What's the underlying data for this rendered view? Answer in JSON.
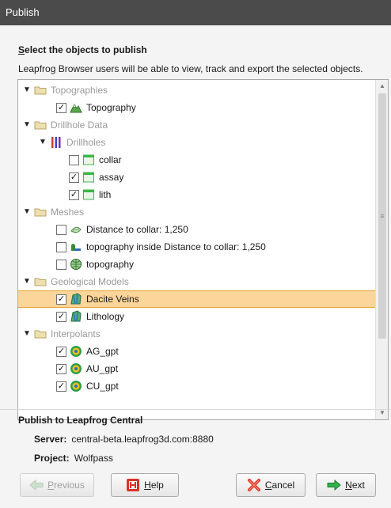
{
  "window": {
    "title": "Publish"
  },
  "section": {
    "title_mnemonic": "S",
    "title_rest": "elect the objects to publish",
    "description": "Leapfrog Browser users will be able to view, track and export the selected objects."
  },
  "tree": [
    {
      "label": "Topographies",
      "grey": true
    },
    {
      "label": "Topography",
      "checked": "✓"
    },
    {
      "label": "Drillhole Data",
      "grey": true
    },
    {
      "label": "Drillholes",
      "grey": true
    },
    {
      "label": "collar",
      "checked": ""
    },
    {
      "label": "assay",
      "checked": "✓"
    },
    {
      "label": "lith",
      "checked": "✓"
    },
    {
      "label": "Meshes",
      "grey": true
    },
    {
      "label": "Distance to collar: 1,250",
      "checked": ""
    },
    {
      "label": "topography inside Distance to collar: 1,250",
      "checked": ""
    },
    {
      "label": "topography",
      "checked": ""
    },
    {
      "label": "Geological Models",
      "grey": true
    },
    {
      "label": "Dacite Veins",
      "checked": "✓",
      "selected": true
    },
    {
      "label": "Lithology",
      "checked": "✓"
    },
    {
      "label": "Interpolants",
      "grey": true
    },
    {
      "label": "AG_gpt",
      "checked": "✓"
    },
    {
      "label": "AU_gpt",
      "checked": "✓"
    },
    {
      "label": "CU_gpt",
      "checked": "✓"
    }
  ],
  "publish": {
    "heading": "Publish to Leapfrog Central",
    "server_label": "Server:",
    "server_value": "central-beta.leapfrog3d.com:8880",
    "project_label": "Project:",
    "project_value": "Wolfpass"
  },
  "buttons": {
    "previous_mn": "P",
    "previous_rest": "revious",
    "help_mn": "H",
    "help_rest": "elp",
    "cancel_mn": "C",
    "cancel_rest": "ancel",
    "next_mn": "N",
    "next_rest": "ext"
  },
  "colors": {
    "selection": "#fcd59a",
    "titlebar": "#4b4b4b",
    "folder": "#e8d9a8",
    "grid_green": "#3db54a"
  }
}
